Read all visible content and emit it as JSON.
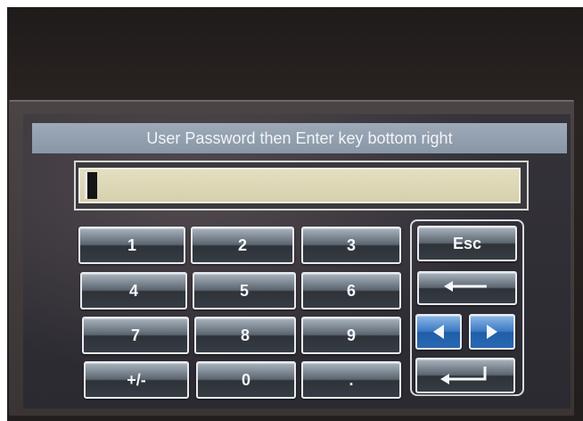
{
  "title": "User Password then Enter key bottom right",
  "password_field": {
    "value": ""
  },
  "keypad": {
    "keys": [
      "1",
      "2",
      "3",
      "4",
      "5",
      "6",
      "7",
      "8",
      "9",
      "+/-",
      "0",
      "."
    ]
  },
  "side_keys": {
    "esc_label": "Esc",
    "backspace_icon": "left-arrow-icon",
    "cursor_left_icon": "triangle-left-icon",
    "cursor_right_icon": "triangle-right-icon",
    "enter_icon": "enter-return-icon"
  },
  "colors": {
    "title_bar": "#8c9aab",
    "entry_field": "#dcd6b4",
    "arrow_keys": "#2f6fba"
  }
}
